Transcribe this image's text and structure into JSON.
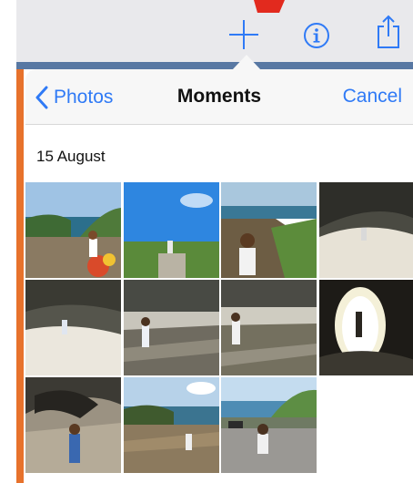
{
  "toolbar": {
    "add_icon": "plus-icon",
    "info_icon": "info-icon",
    "share_icon": "share-icon",
    "accent_color": "#2f7af6"
  },
  "popover": {
    "back_label": "Photos",
    "title": "Moments",
    "cancel_label": "Cancel",
    "section_date": "15 August"
  },
  "photos": [
    {
      "name": "coast-bay"
    },
    {
      "name": "blue-sky-steps"
    },
    {
      "name": "girl-on-path"
    },
    {
      "name": "cave-beach"
    },
    {
      "name": "cave-rocks"
    },
    {
      "name": "boy-on-rocks"
    },
    {
      "name": "girl-on-rocks"
    },
    {
      "name": "tunnel-light"
    },
    {
      "name": "rock-cliff"
    },
    {
      "name": "harbour-rocks"
    },
    {
      "name": "car-park-coast"
    }
  ]
}
